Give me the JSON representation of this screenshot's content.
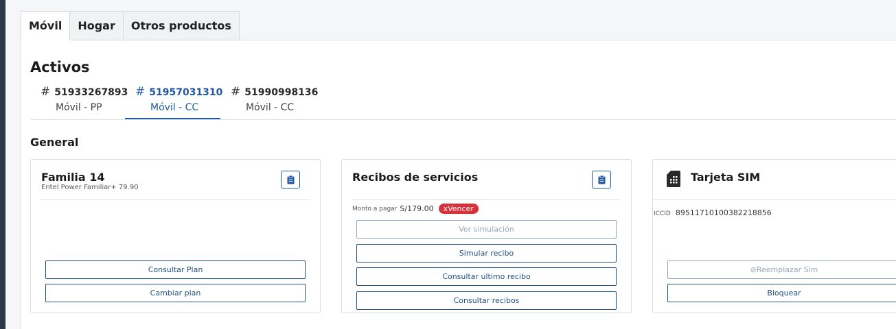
{
  "tabs": [
    {
      "label": "Móvil",
      "active": true
    },
    {
      "label": "Hogar",
      "active": false
    },
    {
      "label": "Otros productos",
      "active": false
    }
  ],
  "activos": {
    "title": "Activos",
    "lines": [
      {
        "number": "51933267893",
        "plan": "Móvil - PP",
        "active": false
      },
      {
        "number": "51957031310",
        "plan": "Móvil - CC",
        "active": true
      },
      {
        "number": "51990998136",
        "plan": "Móvil - CC",
        "active": false
      }
    ]
  },
  "general": {
    "title": "General",
    "plan_card": {
      "title": "Familia 14",
      "subtitle": "Entel Power Familiar+ 79.90",
      "buttons": [
        "Consultar Plan",
        "Cambiar plan"
      ]
    },
    "receipts_card": {
      "title": "Recibos de servicios",
      "amount_label": "Monto a pagar",
      "amount_value": "S/179.00",
      "badge": "xVencer",
      "buttons": {
        "simulation": "Ver simulación",
        "simulate": "Simular recibo",
        "last": "Consultar ultimo recibo",
        "all": "Consultar recibos"
      }
    },
    "sim_card": {
      "title": "Tarjeta SIM",
      "iccid_label": "ICCID",
      "iccid_value": "89511710100382218856",
      "buttons": {
        "replace": "⊘Reemplazar Sim",
        "block": "Bloquear"
      }
    }
  },
  "colors": {
    "accent": "#1f5aa0",
    "badge": "#d6303a",
    "rail": "#2b3a4a"
  }
}
